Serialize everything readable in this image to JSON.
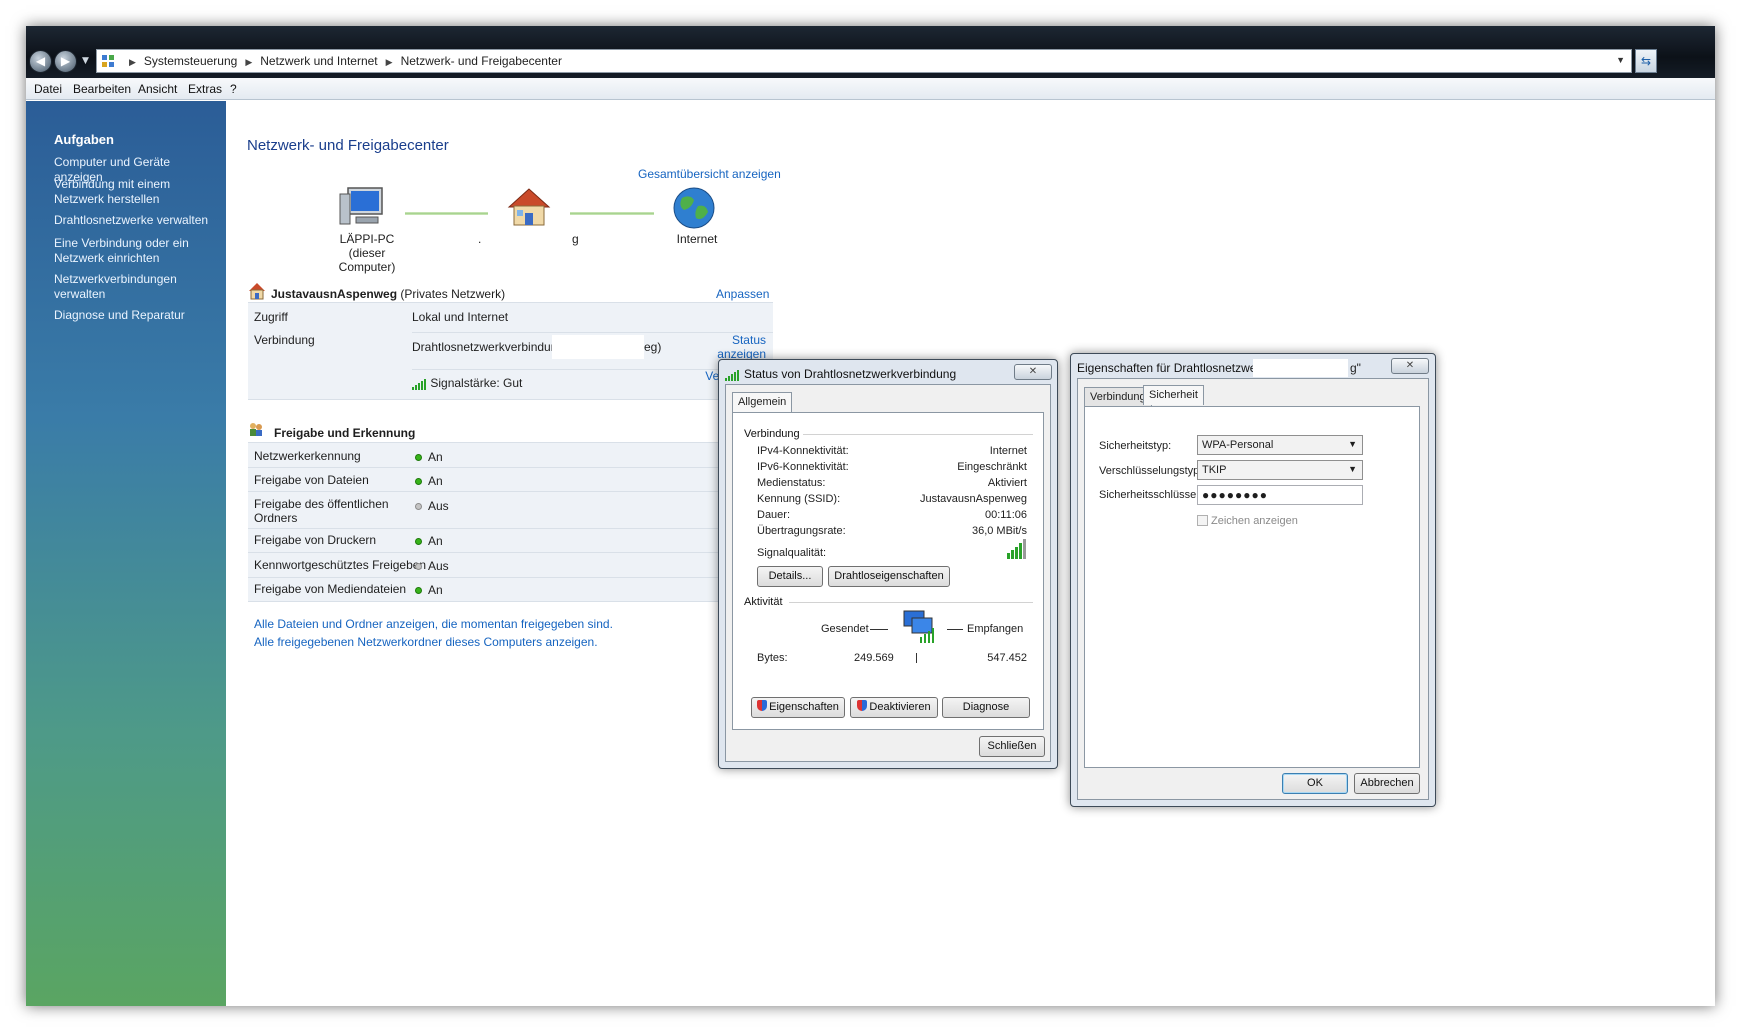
{
  "address": {
    "crumbs": [
      "Systemsteuerung",
      "Netzwerk und Internet",
      "Netzwerk- und Freigabecenter"
    ]
  },
  "menu": [
    "Datei",
    "Bearbeiten",
    "Ansicht",
    "Extras",
    "?"
  ],
  "sidebar": {
    "heading": "Aufgaben",
    "links": [
      "Computer und Geräte anzeigen",
      "Verbindung mit einem Netzwerk herstellen",
      "Drahtlosnetzwerke verwalten",
      "Eine Verbindung oder ein Netzwerk einrichten",
      "Netzwerkverbindungen verwalten",
      "Diagnose und Reparatur"
    ]
  },
  "main": {
    "title": "Netzwerk- und Freigabecenter",
    "overview_link": "Gesamtübersicht anzeigen",
    "map": {
      "computer_name": "LÄPPI-PC",
      "computer_sub": "(dieser Computer)",
      "network_label_dot": ".",
      "network_label_tail": "g",
      "internet_label": "Internet"
    },
    "network": {
      "name": "JustavausnAspenweg",
      "type": "(Privates Netzwerk)",
      "customize": "Anpassen",
      "rows": [
        {
          "label": "Zugriff",
          "value": "Lokal und Internet"
        },
        {
          "label": "Verbindung",
          "value": "Drahtlosnetzwerkverbindung",
          "value_tail": "eg)",
          "link1": "Status anzeigen",
          "link2": "Verbindung trennen"
        }
      ],
      "signal": "Signalstärke: Gut"
    },
    "sharing": {
      "heading": "Freigabe und Erkennung",
      "rows": [
        {
          "label": "Netzwerkerkennung",
          "state": "An",
          "on": true
        },
        {
          "label": "Freigabe von Dateien",
          "state": "An",
          "on": true
        },
        {
          "label": "Freigabe des öffentlichen Ordners",
          "state": "Aus",
          "on": false
        },
        {
          "label": "Freigabe von Druckern",
          "state": "An",
          "on": true
        },
        {
          "label": "Kennwortgeschütztes Freigeben",
          "state": "Aus",
          "on": false
        },
        {
          "label": "Freigabe von Mediendateien",
          "state": "An",
          "on": true
        }
      ]
    },
    "footer_links": [
      "Alle Dateien und Ordner anzeigen, die momentan freigegeben sind.",
      "Alle freigegebenen Netzwerkordner dieses Computers anzeigen."
    ]
  },
  "status_dialog": {
    "title": "Status von Drahtlosnetzwerkverbindung",
    "tab": "Allgemein",
    "connection_group": "Verbindung",
    "fields": [
      {
        "label": "IPv4-Konnektivität:",
        "value": "Internet"
      },
      {
        "label": "IPv6-Konnektivität:",
        "value": "Eingeschränkt"
      },
      {
        "label": "Medienstatus:",
        "value": "Aktiviert"
      },
      {
        "label": "Kennung (SSID):",
        "value": "JustavausnAspenweg"
      },
      {
        "label": "Dauer:",
        "value": "00:11:06"
      },
      {
        "label": "Übertragungsrate:",
        "value": "36,0 MBit/s"
      }
    ],
    "signal_label": "Signalqualität:",
    "signal_level": 5,
    "details_button": "Details...",
    "wireless_props_button": "Drahtloseigenschaften",
    "activity_group": "Aktivität",
    "sent_label": "Gesendet",
    "received_label": "Empfangen",
    "bytes_label": "Bytes:",
    "bytes_sent": "249.569",
    "bytes_received": "547.452",
    "properties_button": "Eigenschaften",
    "disable_button": "Deaktivieren",
    "diagnose_button": "Diagnose",
    "close_button": "Schließen"
  },
  "props_dialog": {
    "title": "Eigenschaften für Drahtlosnetzwerk \"",
    "title_tail": "g\"",
    "tabs": [
      "Verbindung",
      "Sicherheit"
    ],
    "security_type_label": "Sicherheitstyp:",
    "security_type_value": "WPA-Personal",
    "encryption_label": "Verschlüsselungstyp:",
    "encryption_value": "TKIP",
    "key_label": "Sicherheitsschlüssel",
    "key_value": "●●●●●●●●",
    "show_chars_label": "Zeichen anzeigen",
    "ok_button": "OK",
    "cancel_button": "Abbrechen"
  }
}
